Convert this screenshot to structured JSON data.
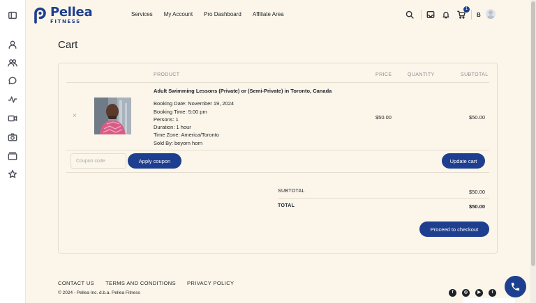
{
  "sidebar": {
    "items": [
      {
        "icon": "sidebar-toggle-icon"
      },
      {
        "icon": "user-icon"
      },
      {
        "icon": "users-icon"
      },
      {
        "icon": "chat-icon"
      },
      {
        "icon": "activity-icon"
      },
      {
        "icon": "video-icon"
      },
      {
        "icon": "camera-icon"
      },
      {
        "icon": "albums-icon"
      },
      {
        "icon": "star-icon"
      }
    ]
  },
  "header": {
    "logo_name": "Pellea",
    "logo_sub": "FITNESS",
    "nav": [
      "Services",
      "My Account",
      "Pro Dashboard",
      "Affiliate Area"
    ],
    "cart_count": "1",
    "user_initial": "B"
  },
  "page": {
    "title": "Cart"
  },
  "cart": {
    "columns": {
      "product": "PRODUCT",
      "price": "PRICE",
      "quantity": "QUANTITY",
      "subtotal": "SUBTOTAL"
    },
    "item": {
      "remove": "×",
      "name": "Adult Swimming Lessons (Private) or (Semi-Private) in Toronto, Canada",
      "meta": [
        "Booking Date: November 19, 2024",
        "Booking Time: 5:00 pm",
        "Persons: 1",
        "Duration: 1 hour",
        "Time Zone: America/Toronto",
        "Sold By: beyorn horn"
      ],
      "price": "$50.00",
      "subtotal": "$50.00"
    },
    "coupon_placeholder": "Coupon code",
    "apply_coupon_label": "Apply coupon",
    "update_cart_label": "Update cart"
  },
  "totals": {
    "subtotal_label": "SUBTOTAL",
    "subtotal_value": "$50.00",
    "total_label": "TOTAL",
    "total_value": "$50.00",
    "checkout_label": "Proceed to checkout"
  },
  "footer": {
    "links": [
      "CONTACT US",
      "TERMS AND CONDITIONS",
      "PRIVACY POLICY"
    ],
    "copyright": "© 2024 - Pellea Inc. d.b.a. Pellea Fitness",
    "social": [
      "facebook-icon",
      "instagram-icon",
      "youtube-icon",
      "twitter-icon"
    ]
  },
  "colors": {
    "brand": "#1e3f8f",
    "background": "#fbf5ea"
  }
}
